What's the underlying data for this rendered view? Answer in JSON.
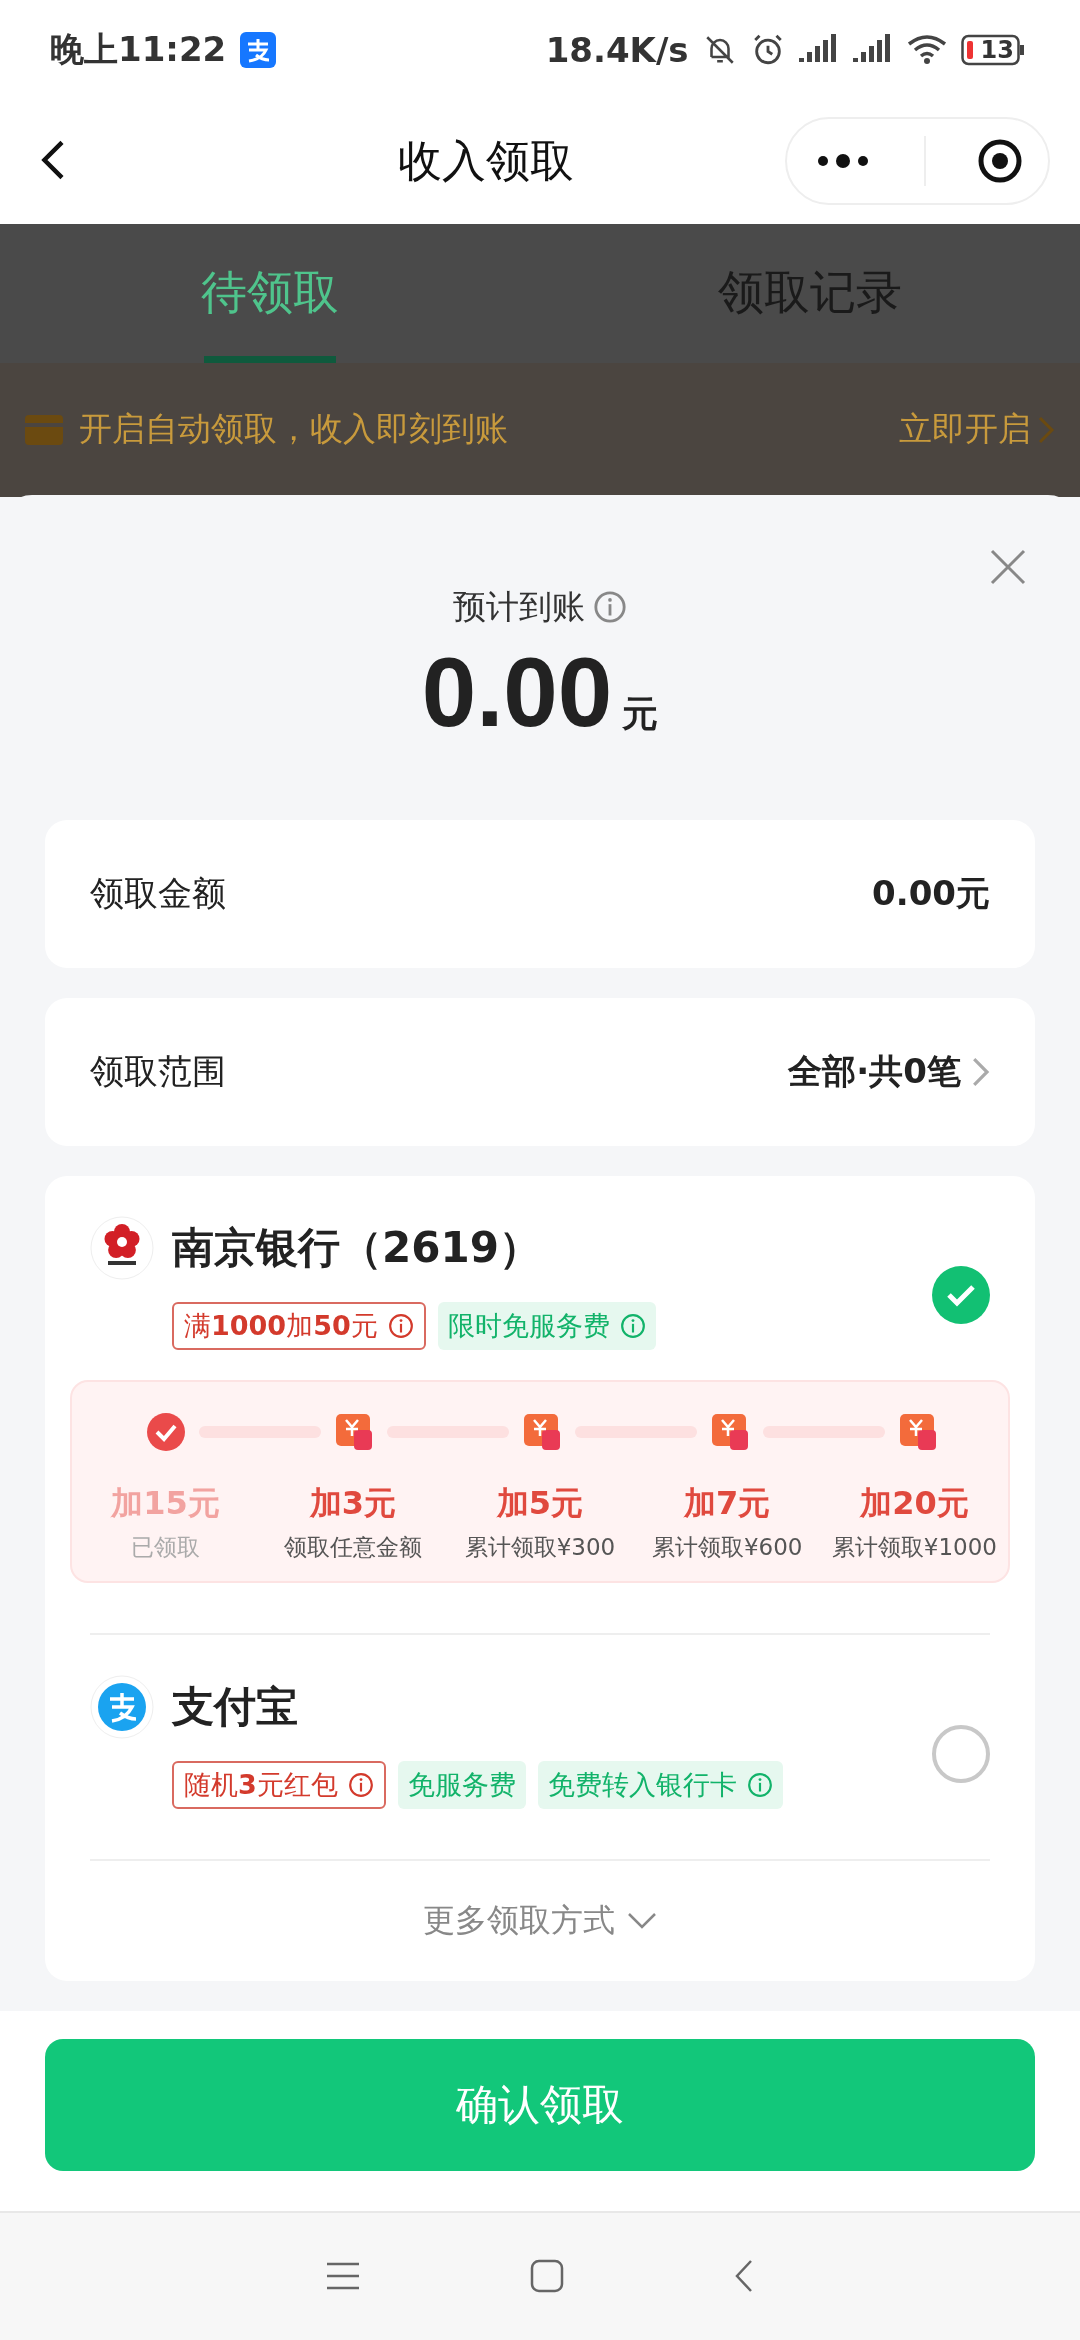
{
  "status_bar": {
    "time": "晚上11:22",
    "net_speed": "18.4K/s",
    "battery": "13"
  },
  "nav": {
    "title": "收入领取"
  },
  "tabs": [
    {
      "label": "待领取",
      "selected": true
    },
    {
      "label": "领取记录",
      "selected": false
    }
  ],
  "banner": {
    "text": "开启自动领取，收入即刻到账",
    "action": "立即开启"
  },
  "sheet": {
    "estimate_label": "预计到账",
    "amount": "0.00",
    "unit": "元",
    "rows": [
      {
        "label": "领取金额",
        "value": "0.00元",
        "chevron": false
      },
      {
        "label": "领取范围",
        "value": "全部·共0笔",
        "chevron": true
      }
    ],
    "methods": [
      {
        "kind": "bank",
        "name": "南京银行（2619）",
        "selected": true,
        "tags": [
          {
            "kind": "promo",
            "text": "满**1000**加**50**元",
            "info": true
          },
          {
            "kind": "benefit",
            "text": "限时免服务费",
            "info": true
          }
        ],
        "milestones": [
          {
            "amount": "加15元",
            "note": "已领取",
            "claimed": true
          },
          {
            "amount": "加3元",
            "note": "领取任意金额",
            "claimed": false
          },
          {
            "amount": "加5元",
            "note": "累计领取¥300",
            "claimed": false
          },
          {
            "amount": "加7元",
            "note": "累计领取¥600",
            "claimed": false
          },
          {
            "amount": "加20元",
            "note": "累计领取¥1000",
            "claimed": false
          }
        ]
      },
      {
        "kind": "alipay",
        "name": "支付宝",
        "selected": false,
        "tags": [
          {
            "kind": "promo",
            "text": "随机**3**元红包",
            "info": true
          },
          {
            "kind": "benefit",
            "text": "免服务费",
            "info": false
          },
          {
            "kind": "benefit",
            "text": "免费转入银行卡",
            "info": true
          }
        ]
      }
    ],
    "more": "更多领取方式"
  },
  "confirm_button": "确认领取"
}
